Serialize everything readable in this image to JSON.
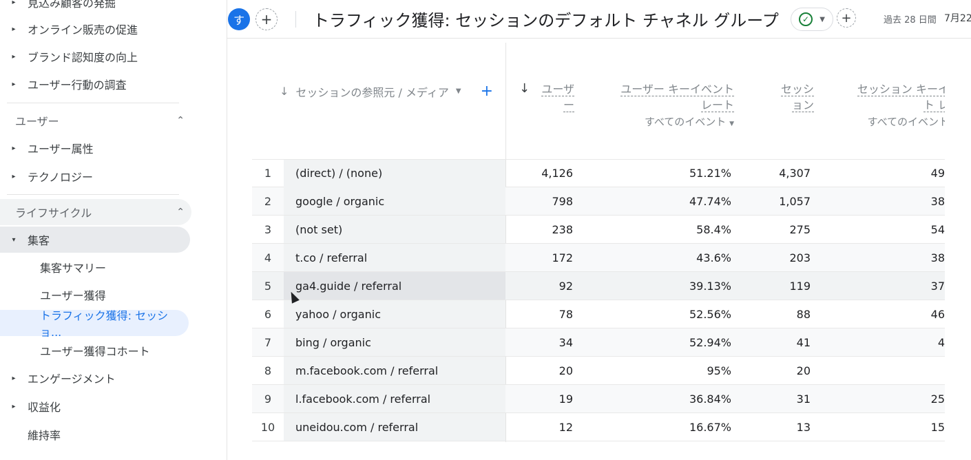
{
  "sidebar": {
    "items_top": [
      {
        "label": "見込み顧客の発掘"
      },
      {
        "label": "オンライン販売の促進"
      },
      {
        "label": "ブランド認知度の向上"
      },
      {
        "label": "ユーザー行動の調査"
      }
    ],
    "section_user": "ユーザー",
    "user_items": [
      {
        "label": "ユーザー属性"
      },
      {
        "label": "テクノロジー"
      }
    ],
    "section_lifecycle": "ライフサイクル",
    "acquisition": "集客",
    "acquisition_children": [
      {
        "label": "集客サマリー"
      },
      {
        "label": "ユーザー獲得"
      },
      {
        "label": "トラフィック獲得: セッショ..."
      },
      {
        "label": "ユーザー獲得コホート"
      }
    ],
    "bottom_items": [
      {
        "label": "エンゲージメント"
      },
      {
        "label": "収益化"
      },
      {
        "label": "維持率"
      }
    ]
  },
  "header": {
    "avatar": "す",
    "add": "+",
    "title": "トラフィック獲得: セッションのデフォルト チャネル グループ",
    "status_icon": "check-circle-icon",
    "add2": "+",
    "date_range": "過去 28 日間",
    "date_value": "7月22"
  },
  "table": {
    "dimension_header": "セッションの参照元 / メディア",
    "metrics": [
      {
        "line1": "ユーザ",
        "line2": "ー",
        "sub": ""
      },
      {
        "line1": "ユーザー キーイベント",
        "line2": "レート",
        "sub": "すべてのイベント"
      },
      {
        "line1": "セッシ",
        "line2": "ョン",
        "sub": ""
      },
      {
        "line1": "セッション キーイ",
        "line2": "ト レ",
        "sub": "すべてのイベント"
      }
    ],
    "rows": [
      {
        "idx": "1",
        "dim": "(direct) / (none)",
        "users": "4,126",
        "rate": "51.21%",
        "sessions": "4,307",
        "srate": "49"
      },
      {
        "idx": "2",
        "dim": "google / organic",
        "users": "798",
        "rate": "47.74%",
        "sessions": "1,057",
        "srate": "38"
      },
      {
        "idx": "3",
        "dim": "(not set)",
        "users": "238",
        "rate": "58.4%",
        "sessions": "275",
        "srate": "54"
      },
      {
        "idx": "4",
        "dim": "t.co / referral",
        "users": "172",
        "rate": "43.6%",
        "sessions": "203",
        "srate": "38"
      },
      {
        "idx": "5",
        "dim": "ga4.guide / referral",
        "users": "92",
        "rate": "39.13%",
        "sessions": "119",
        "srate": "37"
      },
      {
        "idx": "6",
        "dim": "yahoo / organic",
        "users": "78",
        "rate": "52.56%",
        "sessions": "88",
        "srate": "46"
      },
      {
        "idx": "7",
        "dim": "bing / organic",
        "users": "34",
        "rate": "52.94%",
        "sessions": "41",
        "srate": "4"
      },
      {
        "idx": "8",
        "dim": "m.facebook.com / referral",
        "users": "20",
        "rate": "95%",
        "sessions": "20",
        "srate": ""
      },
      {
        "idx": "9",
        "dim": "l.facebook.com / referral",
        "users": "19",
        "rate": "36.84%",
        "sessions": "31",
        "srate": "25"
      },
      {
        "idx": "10",
        "dim": "uneidou.com / referral",
        "users": "12",
        "rate": "16.67%",
        "sessions": "13",
        "srate": "15"
      }
    ]
  }
}
